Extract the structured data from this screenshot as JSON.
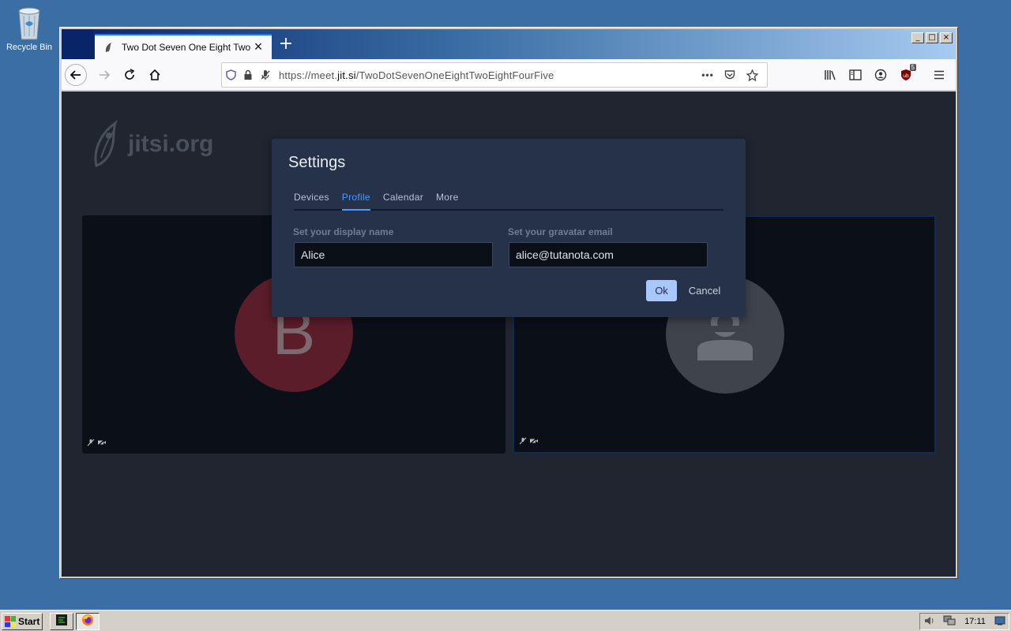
{
  "desktop": {
    "recycle_bin_label": "Recycle Bin"
  },
  "browser": {
    "tab_title": "Two Dot Seven One Eight Two Eight Four Five",
    "url_prefix": "https://meet.",
    "url_domain": "jit.si",
    "url_path": "/TwoDotSevenOneEightTwoEightFourFive",
    "ublock_count": "5",
    "accent_color": "#0a84ff"
  },
  "page": {
    "watermark_text": "jitsi.org",
    "participant_initial": "B"
  },
  "settings": {
    "title": "Settings",
    "tabs": [
      {
        "label": "Devices"
      },
      {
        "label": "Profile"
      },
      {
        "label": "Calendar"
      },
      {
        "label": "More"
      }
    ],
    "active_tab": "Profile",
    "display_name_label": "Set your display name",
    "display_name_value": "Alice",
    "gravatar_label": "Set your gravatar email",
    "gravatar_value": "alice@tutanota.com",
    "ok_label": "Ok",
    "cancel_label": "Cancel",
    "active_tab_color": "#4c9aff"
  },
  "taskbar": {
    "start_label": "Start",
    "clock": "17:11"
  }
}
